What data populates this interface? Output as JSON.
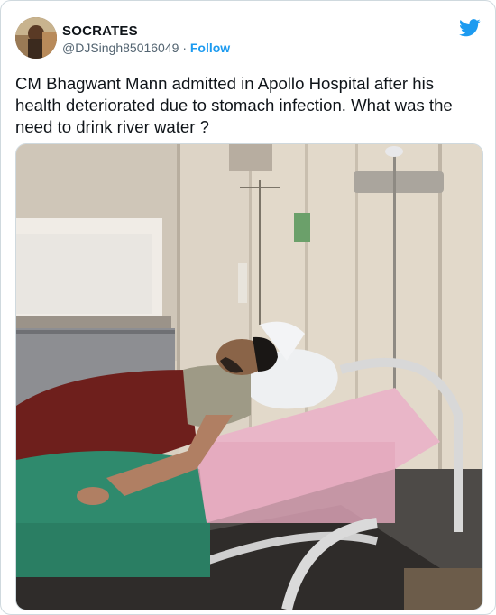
{
  "author": {
    "display_name": "SOCRATES",
    "handle": "@DJSingh85016049",
    "separator": "·",
    "follow_label": "Follow"
  },
  "tweet": {
    "text": "CM Bhagwant Mann admitted in Apollo Hospital after his health deteriorated due to stomach infection. What was the need to drink river water ?"
  },
  "icons": {
    "brand": "twitter-bird-icon",
    "brand_color": "#1d9bf0"
  },
  "media": {
    "type": "photo"
  },
  "colors": {
    "link": "#1d9bf0",
    "secondary_text": "#536471",
    "border": "#cfd9de"
  }
}
